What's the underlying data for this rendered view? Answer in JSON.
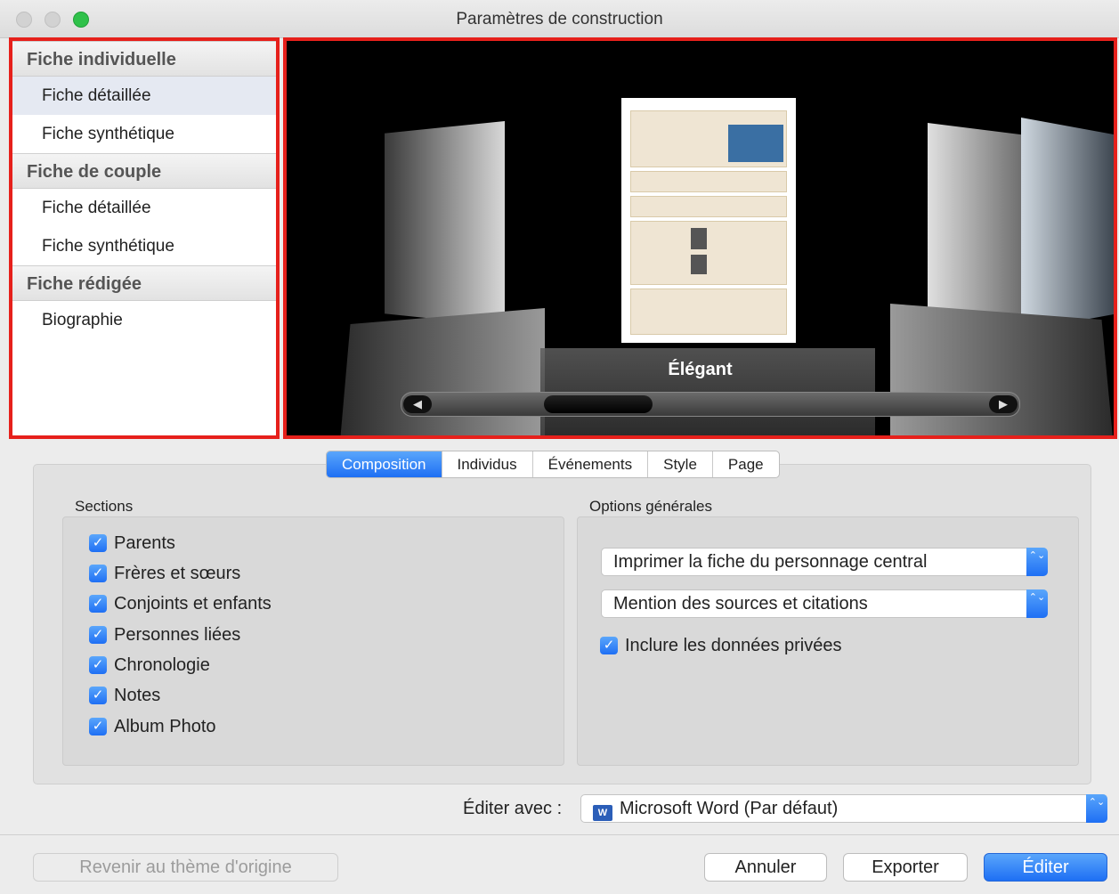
{
  "window": {
    "title": "Paramètres de construction"
  },
  "sidebar": {
    "groups": [
      {
        "title": "Fiche individuelle",
        "items": [
          "Fiche détaillée",
          "Fiche synthétique"
        ]
      },
      {
        "title": "Fiche de couple",
        "items": [
          "Fiche détaillée",
          "Fiche synthétique"
        ]
      },
      {
        "title": "Fiche rédigée",
        "items": [
          "Biographie"
        ]
      }
    ],
    "selected": "Fiche individuelle / Fiche détaillée"
  },
  "preview": {
    "theme_label": "Élégant",
    "scroller_left": "◀",
    "scroller_right": "▶"
  },
  "tabs": [
    "Composition",
    "Individus",
    "Événements",
    "Style",
    "Page"
  ],
  "active_tab": "Composition",
  "sections": {
    "title": "Sections",
    "items": [
      {
        "label": "Parents",
        "checked": true
      },
      {
        "label": "Frères et sœurs",
        "checked": true
      },
      {
        "label": "Conjoints et enfants",
        "checked": true
      },
      {
        "label": "Personnes liées",
        "checked": true
      },
      {
        "label": "Chronologie",
        "checked": true
      },
      {
        "label": "Notes",
        "checked": true
      },
      {
        "label": "Album Photo",
        "checked": true
      }
    ]
  },
  "options": {
    "title": "Options générales",
    "print_select": "Imprimer la fiche du personnage central",
    "sources_select": "Mention des sources et citations",
    "private_label": "Inclure les données privées",
    "private_checked": true
  },
  "editor": {
    "label": "Éditer avec :",
    "icon_text": "W",
    "value": "Microsoft Word (Par défaut)"
  },
  "buttons": {
    "reset": "Revenir au thème d'origine",
    "cancel": "Annuler",
    "export": "Exporter",
    "edit": "Éditer"
  },
  "glyphs": {
    "check": "✓",
    "stepper": "⌃⌄"
  },
  "colors": {
    "accent": "#1e6ff4",
    "highlight_border": "#e6201b"
  }
}
